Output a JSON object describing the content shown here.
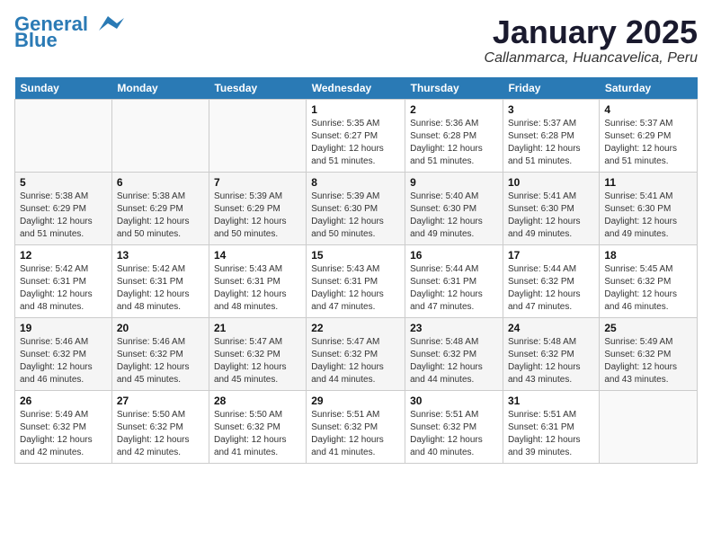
{
  "header": {
    "logo_line1": "General",
    "logo_line2": "Blue",
    "title": "January 2025",
    "subtitle": "Callanmarca, Huancavelica, Peru"
  },
  "weekdays": [
    "Sunday",
    "Monday",
    "Tuesday",
    "Wednesday",
    "Thursday",
    "Friday",
    "Saturday"
  ],
  "weeks": [
    [
      {
        "day": "",
        "info": ""
      },
      {
        "day": "",
        "info": ""
      },
      {
        "day": "",
        "info": ""
      },
      {
        "day": "1",
        "info": "Sunrise: 5:35 AM\nSunset: 6:27 PM\nDaylight: 12 hours\nand 51 minutes."
      },
      {
        "day": "2",
        "info": "Sunrise: 5:36 AM\nSunset: 6:28 PM\nDaylight: 12 hours\nand 51 minutes."
      },
      {
        "day": "3",
        "info": "Sunrise: 5:37 AM\nSunset: 6:28 PM\nDaylight: 12 hours\nand 51 minutes."
      },
      {
        "day": "4",
        "info": "Sunrise: 5:37 AM\nSunset: 6:29 PM\nDaylight: 12 hours\nand 51 minutes."
      }
    ],
    [
      {
        "day": "5",
        "info": "Sunrise: 5:38 AM\nSunset: 6:29 PM\nDaylight: 12 hours\nand 51 minutes."
      },
      {
        "day": "6",
        "info": "Sunrise: 5:38 AM\nSunset: 6:29 PM\nDaylight: 12 hours\nand 50 minutes."
      },
      {
        "day": "7",
        "info": "Sunrise: 5:39 AM\nSunset: 6:29 PM\nDaylight: 12 hours\nand 50 minutes."
      },
      {
        "day": "8",
        "info": "Sunrise: 5:39 AM\nSunset: 6:30 PM\nDaylight: 12 hours\nand 50 minutes."
      },
      {
        "day": "9",
        "info": "Sunrise: 5:40 AM\nSunset: 6:30 PM\nDaylight: 12 hours\nand 49 minutes."
      },
      {
        "day": "10",
        "info": "Sunrise: 5:41 AM\nSunset: 6:30 PM\nDaylight: 12 hours\nand 49 minutes."
      },
      {
        "day": "11",
        "info": "Sunrise: 5:41 AM\nSunset: 6:30 PM\nDaylight: 12 hours\nand 49 minutes."
      }
    ],
    [
      {
        "day": "12",
        "info": "Sunrise: 5:42 AM\nSunset: 6:31 PM\nDaylight: 12 hours\nand 48 minutes."
      },
      {
        "day": "13",
        "info": "Sunrise: 5:42 AM\nSunset: 6:31 PM\nDaylight: 12 hours\nand 48 minutes."
      },
      {
        "day": "14",
        "info": "Sunrise: 5:43 AM\nSunset: 6:31 PM\nDaylight: 12 hours\nand 48 minutes."
      },
      {
        "day": "15",
        "info": "Sunrise: 5:43 AM\nSunset: 6:31 PM\nDaylight: 12 hours\nand 47 minutes."
      },
      {
        "day": "16",
        "info": "Sunrise: 5:44 AM\nSunset: 6:31 PM\nDaylight: 12 hours\nand 47 minutes."
      },
      {
        "day": "17",
        "info": "Sunrise: 5:44 AM\nSunset: 6:32 PM\nDaylight: 12 hours\nand 47 minutes."
      },
      {
        "day": "18",
        "info": "Sunrise: 5:45 AM\nSunset: 6:32 PM\nDaylight: 12 hours\nand 46 minutes."
      }
    ],
    [
      {
        "day": "19",
        "info": "Sunrise: 5:46 AM\nSunset: 6:32 PM\nDaylight: 12 hours\nand 46 minutes."
      },
      {
        "day": "20",
        "info": "Sunrise: 5:46 AM\nSunset: 6:32 PM\nDaylight: 12 hours\nand 45 minutes."
      },
      {
        "day": "21",
        "info": "Sunrise: 5:47 AM\nSunset: 6:32 PM\nDaylight: 12 hours\nand 45 minutes."
      },
      {
        "day": "22",
        "info": "Sunrise: 5:47 AM\nSunset: 6:32 PM\nDaylight: 12 hours\nand 44 minutes."
      },
      {
        "day": "23",
        "info": "Sunrise: 5:48 AM\nSunset: 6:32 PM\nDaylight: 12 hours\nand 44 minutes."
      },
      {
        "day": "24",
        "info": "Sunrise: 5:48 AM\nSunset: 6:32 PM\nDaylight: 12 hours\nand 43 minutes."
      },
      {
        "day": "25",
        "info": "Sunrise: 5:49 AM\nSunset: 6:32 PM\nDaylight: 12 hours\nand 43 minutes."
      }
    ],
    [
      {
        "day": "26",
        "info": "Sunrise: 5:49 AM\nSunset: 6:32 PM\nDaylight: 12 hours\nand 42 minutes."
      },
      {
        "day": "27",
        "info": "Sunrise: 5:50 AM\nSunset: 6:32 PM\nDaylight: 12 hours\nand 42 minutes."
      },
      {
        "day": "28",
        "info": "Sunrise: 5:50 AM\nSunset: 6:32 PM\nDaylight: 12 hours\nand 41 minutes."
      },
      {
        "day": "29",
        "info": "Sunrise: 5:51 AM\nSunset: 6:32 PM\nDaylight: 12 hours\nand 41 minutes."
      },
      {
        "day": "30",
        "info": "Sunrise: 5:51 AM\nSunset: 6:32 PM\nDaylight: 12 hours\nand 40 minutes."
      },
      {
        "day": "31",
        "info": "Sunrise: 5:51 AM\nSunset: 6:31 PM\nDaylight: 12 hours\nand 39 minutes."
      },
      {
        "day": "",
        "info": ""
      }
    ]
  ]
}
